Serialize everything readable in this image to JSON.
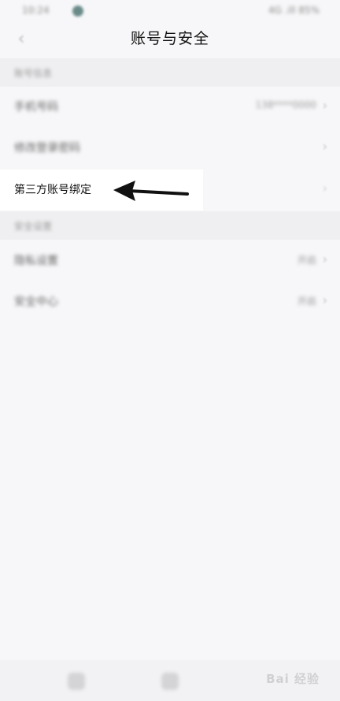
{
  "status_bar": {
    "time": "10:24",
    "right_text": "4G .ill 85%"
  },
  "header": {
    "back_icon": "chevron-left-icon",
    "title": "账号与安全"
  },
  "sections": [
    {
      "header": "账号信息",
      "rows": [
        {
          "label": "手机号码",
          "value": "138****0000"
        },
        {
          "label": "修改登录密码",
          "value": ""
        },
        {
          "label": "第三方账号绑定",
          "value": ""
        }
      ]
    },
    {
      "header": "安全设置",
      "rows": [
        {
          "label": "隐私设置",
          "value": "开启"
        },
        {
          "label": "安全中心",
          "value": "开启"
        }
      ]
    }
  ],
  "annotation": {
    "arrow_icon": "arrow-left-icon",
    "color": "#111111"
  },
  "watermark": {
    "text": "Bai 经验"
  },
  "colors": {
    "background": "#f7f7f9",
    "section_header_bg": "#efeff1",
    "highlight_bg": "#ffffff"
  }
}
